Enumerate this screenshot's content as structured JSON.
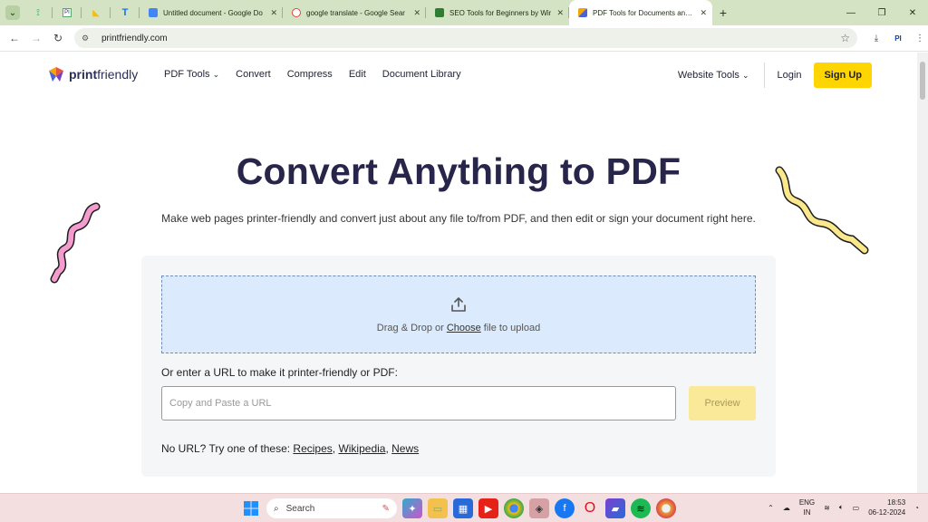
{
  "browser": {
    "tabs": [
      {
        "title": "Untitled document - Google Do",
        "favicon_color": "#4285f4",
        "active": false
      },
      {
        "title": "google translate - Google Sear",
        "favicon_color": "#ea4335",
        "active": false
      },
      {
        "title": "SEO Tools for Beginners by Wir",
        "favicon_color": "#2e7d32",
        "active": false
      },
      {
        "title": "PDF Tools for Documents and W",
        "favicon_color": "#f6a400",
        "active": true
      }
    ],
    "new_tab": "+",
    "address": "printfriendly.com"
  },
  "site": {
    "logo": {
      "bold": "print",
      "regular": "friendly"
    },
    "nav": [
      "PDF Tools",
      "Convert",
      "Compress",
      "Edit",
      "Document Library"
    ],
    "website_tools": "Website Tools",
    "login": "Login",
    "signup": "Sign Up"
  },
  "hero": {
    "title": "Convert Anything to PDF",
    "subtitle": "Make web pages printer-friendly and convert just about any file to/from PDF, and then edit or sign your document right here."
  },
  "upload": {
    "prefix": "Drag & Drop or ",
    "choose": "Choose",
    "suffix": " file to upload",
    "url_label": "Or enter a URL to make it printer-friendly or PDF:",
    "url_placeholder": "Copy and Paste a URL",
    "preview": "Preview",
    "try_prefix": "No URL? Try one of these: ",
    "try_links": [
      "Recipes",
      "Wikipedia",
      "News"
    ]
  },
  "taskbar": {
    "search": "Search",
    "lang_top": "ENG",
    "lang_bottom": "IN",
    "time": "18:53",
    "date": "06-12-2024"
  },
  "colors": {
    "brand_yellow": "#ffd500",
    "dropzone": "#dbeafc",
    "title": "#27264a",
    "tabbar": "#d3e3c4"
  }
}
